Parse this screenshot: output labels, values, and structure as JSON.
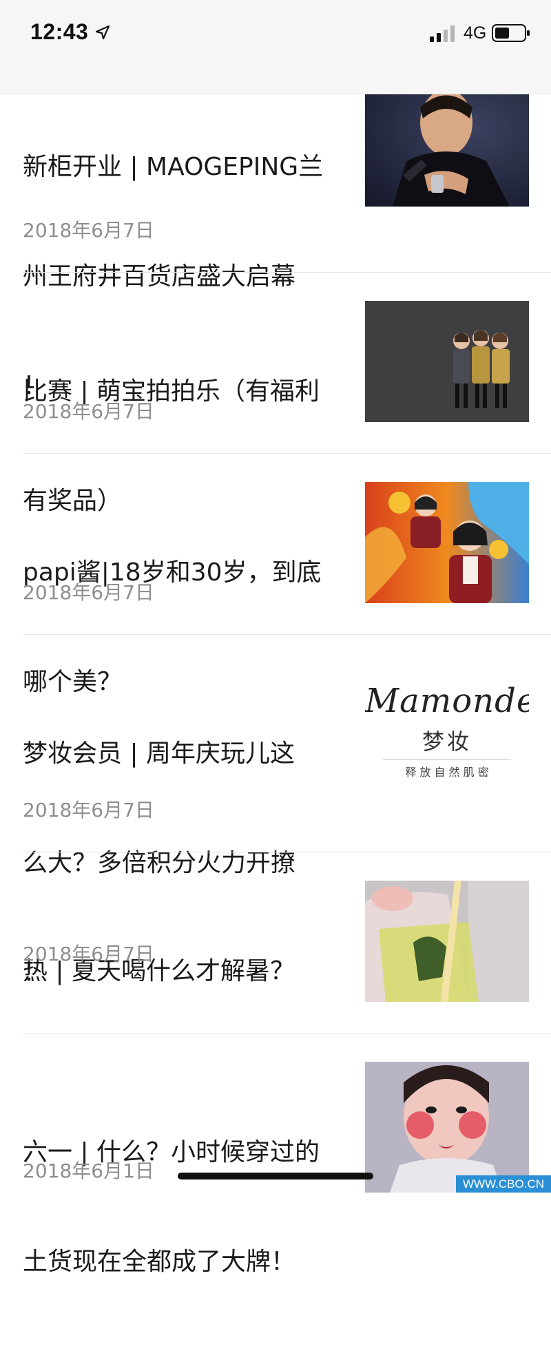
{
  "status_bar": {
    "time": "12:43",
    "network": "4G",
    "icons": [
      "location-arrow-icon",
      "cellular-signal-icon",
      "battery-icon"
    ]
  },
  "articles": [
    {
      "title": "新柜开业 | MAOGEPING兰州王府井百货店盛大启幕！",
      "title_lines": [
        "新柜开业 | MAOGEPING兰",
        "州王府井百货店盛大启幕",
        "！"
      ],
      "date": "2018年6月7日",
      "thumbnail": "man-portrait-photo"
    },
    {
      "title": "比赛 | 萌宝拍拍乐（有福利有奖品）",
      "title_lines": [
        "比赛 | 萌宝拍拍乐（有福利",
        "有奖品）"
      ],
      "date": "2018年6月7日",
      "thumbnail": "three-girls-photo"
    },
    {
      "title": "papi酱|18岁和30岁，到底哪个美？",
      "title_lines": [
        "papi酱|18岁和30岁，到底",
        "哪个美？"
      ],
      "date": "2018年6月7日",
      "thumbnail": "papi-video-cover"
    },
    {
      "title": "梦妆会员 | 周年庆玩儿这么大？多倍积分火力开撩！",
      "title_lines": [
        "梦妆会员 | 周年庆玩儿这",
        "么大？多倍积分火力开撩",
        "！"
      ],
      "date": "2018年6月7日",
      "thumbnail": "mamonde-logo",
      "logo_text": {
        "brand": "Mamonde",
        "brand_cn": "梦妆",
        "slogan": "释 放 自 然 肌 密"
      }
    },
    {
      "title": "热 | 夏天喝什么才解暑？",
      "title_lines": [
        "热 | 夏天喝什么才解暑？"
      ],
      "date": "2018年6月7日",
      "thumbnail": "drink-pouch-photo"
    },
    {
      "title": "六一 | 什么？小时候穿过的土货现在全都成了大牌！",
      "title_lines": [
        "六一 | 什么？小时候穿过的",
        "土货现在全都成了大牌！"
      ],
      "date": "2018年6月1日",
      "thumbnail": "child-makeup-photo"
    }
  ],
  "watermark": "WWW.CBO.CN",
  "colors": {
    "status_bg": "#f6f6f6",
    "date_gray": "#8e8e8e",
    "divider": "#e4e4e4",
    "watermark_bg": "#2b8fd6"
  }
}
